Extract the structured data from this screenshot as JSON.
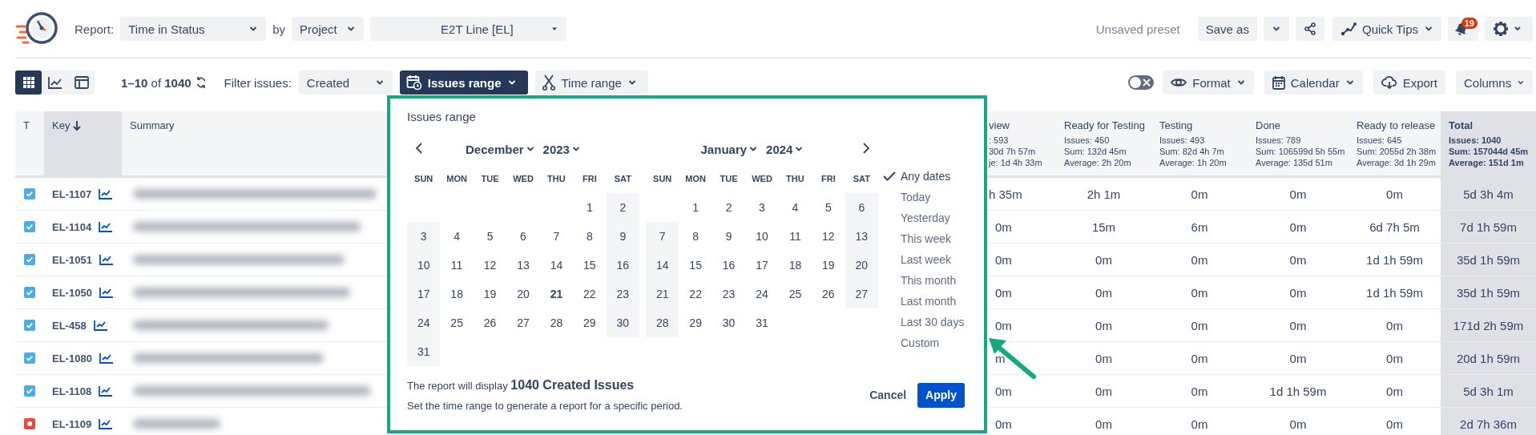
{
  "header": {
    "report_label": "Report:",
    "report_select": "Time in Status",
    "by_label": "by",
    "group_select": "Project",
    "project_select": "E2T Line [EL]",
    "preset_status": "Unsaved preset",
    "save_as": "Save as",
    "quick_tips": "Quick Tips",
    "notifications": "19"
  },
  "toolbar": {
    "view_modes": [
      {
        "selected": true
      },
      {
        "selected": false
      },
      {
        "selected": false
      }
    ],
    "pagination": "**1–10** of **1040**",
    "filter_label": "Filter issues:",
    "filter_select": "Created",
    "issues_range": {
      "label": "Issues range",
      "open": true
    },
    "time_range": {
      "label": "Time range",
      "open": false
    },
    "toggle": {
      "on": false
    },
    "format": "Format",
    "calendar": "Calendar",
    "export": "Export",
    "columns": "Columns"
  },
  "table": {
    "fixed_columns": [
      {
        "label": "T",
        "sorted": false
      },
      {
        "label": "Key",
        "sorted": true
      },
      {
        "label": "Summary",
        "sorted": false
      }
    ],
    "status_columns": [
      {
        "label": "view",
        "stats": [
          ": 593",
          "30d 7h 57m",
          "je: 1d 4h 33m"
        ]
      },
      {
        "label": "Ready for Testing",
        "stats": [
          "Issues: 450",
          "Sum: 132d 45m",
          "Average: 2h 20m"
        ]
      },
      {
        "label": "Testing",
        "stats": [
          "Issues: 493",
          "Sum: 82d 4h 7m",
          "Average: 1h 20m"
        ]
      },
      {
        "label": "Done",
        "stats": [
          "Issues: 789",
          "Sum: 106599d 5h 55m",
          "Average: 135d 51m"
        ]
      },
      {
        "label": "Ready to release",
        "stats": [
          "Issues: 645",
          "Sum: 2055d 2h 38m",
          "Average: 3d 1h 29m"
        ]
      },
      {
        "label": "Total",
        "stats": [
          "Issues: 1040",
          "Sum: 157044d 45m",
          "Average: 151d 1m"
        ]
      }
    ],
    "issues": [
      {
        "kind": "task",
        "key": "EL-1107",
        "times": [
          "h 35m",
          "2h 1m",
          "0m",
          "0m",
          "0m",
          "5d 3h 4m"
        ]
      },
      {
        "kind": "task",
        "key": "EL-1104",
        "times": [
          "0m",
          "15m",
          "6m",
          "0m",
          "6d 7h 5m",
          "7d 1h 59m"
        ]
      },
      {
        "kind": "task",
        "key": "EL-1051",
        "times": [
          "0m",
          "0m",
          "0m",
          "0m",
          "1d 1h 59m",
          "35d 1h 59m"
        ]
      },
      {
        "kind": "task",
        "key": "EL-1050",
        "times": [
          "0m",
          "0m",
          "0m",
          "0m",
          "1d 1h 59m",
          "35d 1h 59m"
        ]
      },
      {
        "kind": "task",
        "key": "EL-458",
        "times": [
          "0m",
          "0m",
          "0m",
          "0m",
          "0m",
          "171d 2h 59m"
        ]
      },
      {
        "kind": "task",
        "key": "EL-1080",
        "times": [
          "m",
          "0m",
          "0m",
          "0m",
          "0m",
          "20d 1h 59m"
        ]
      },
      {
        "kind": "task",
        "key": "EL-1108",
        "times": [
          "0m",
          "0m",
          "0m",
          "1d 1h 59m",
          "0m",
          "5d 3h 1m"
        ]
      },
      {
        "kind": "bug",
        "key": "EL-1109",
        "times": [
          "0m",
          "0m",
          "0m",
          "0m",
          "0m",
          "2d 7h 36m"
        ]
      }
    ]
  },
  "popup": {
    "title": "Issues range",
    "months": [
      {
        "month": "December",
        "year": "2023",
        "weekdays": [
          "SUN",
          "MON",
          "TUE",
          "WED",
          "THU",
          "FRI",
          "SAT"
        ],
        "weeks": [
          {
            "right_aligned": true,
            "days": [
              {
                "day": "1",
                "today": false
              },
              {
                "day": "2",
                "today": false
              }
            ]
          },
          {
            "days": [
              {
                "day": "3",
                "today": false
              },
              {
                "day": "4",
                "today": false
              },
              {
                "day": "5",
                "today": false
              },
              {
                "day": "6",
                "today": false
              },
              {
                "day": "7",
                "today": false
              },
              {
                "day": "8",
                "today": false
              },
              {
                "day": "9",
                "today": false
              }
            ]
          },
          {
            "days": [
              {
                "day": "10",
                "today": false
              },
              {
                "day": "11",
                "today": false
              },
              {
                "day": "12",
                "today": false
              },
              {
                "day": "13",
                "today": false
              },
              {
                "day": "14",
                "today": false
              },
              {
                "day": "15",
                "today": false
              },
              {
                "day": "16",
                "today": false
              }
            ]
          },
          {
            "days": [
              {
                "day": "17",
                "today": false
              },
              {
                "day": "18",
                "today": false
              },
              {
                "day": "19",
                "today": false
              },
              {
                "day": "20",
                "today": false
              },
              {
                "day": "21",
                "today": true
              },
              {
                "day": "22",
                "today": false
              },
              {
                "day": "23",
                "today": false
              }
            ]
          },
          {
            "days": [
              {
                "day": "24",
                "today": false
              },
              {
                "day": "25",
                "today": false
              },
              {
                "day": "26",
                "today": false
              },
              {
                "day": "27",
                "today": false
              },
              {
                "day": "28",
                "today": false
              },
              {
                "day": "29",
                "today": false
              },
              {
                "day": "30",
                "today": false
              }
            ]
          },
          {
            "right_aligned": false,
            "days": [
              {
                "day": "31",
                "today": false
              }
            ]
          }
        ]
      },
      {
        "month": "January",
        "year": "2024",
        "weekdays": [
          "SUN",
          "MON",
          "TUE",
          "WED",
          "THU",
          "FRI",
          "SAT"
        ],
        "weeks": [
          {
            "right_aligned": true,
            "days": [
              {
                "day": "1",
                "today": false
              },
              {
                "day": "2",
                "today": false
              },
              {
                "day": "3",
                "today": false
              },
              {
                "day": "4",
                "today": false
              },
              {
                "day": "5",
                "today": false
              },
              {
                "day": "6",
                "today": false
              }
            ]
          },
          {
            "days": [
              {
                "day": "7",
                "today": false
              },
              {
                "day": "8",
                "today": false
              },
              {
                "day": "9",
                "today": false
              },
              {
                "day": "10",
                "today": false
              },
              {
                "day": "11",
                "today": false
              },
              {
                "day": "12",
                "today": false
              },
              {
                "day": "13",
                "today": false
              }
            ]
          },
          {
            "days": [
              {
                "day": "14",
                "today": false
              },
              {
                "day": "15",
                "today": false
              },
              {
                "day": "16",
                "today": false
              },
              {
                "day": "17",
                "today": false
              },
              {
                "day": "18",
                "today": false
              },
              {
                "day": "19",
                "today": false
              },
              {
                "day": "20",
                "today": false
              }
            ]
          },
          {
            "days": [
              {
                "day": "21",
                "today": false
              },
              {
                "day": "22",
                "today": false
              },
              {
                "day": "23",
                "today": false
              },
              {
                "day": "24",
                "today": false
              },
              {
                "day": "25",
                "today": false
              },
              {
                "day": "26",
                "today": false
              },
              {
                "day": "27",
                "today": false
              }
            ]
          },
          {
            "right_aligned": false,
            "days": [
              {
                "day": "28",
                "today": false
              },
              {
                "day": "29",
                "today": false
              },
              {
                "day": "30",
                "today": false
              },
              {
                "day": "31",
                "today": false
              }
            ]
          }
        ]
      }
    ],
    "presets": [
      {
        "label": "Any dates",
        "selected": true
      },
      {
        "label": "Today",
        "selected": false
      },
      {
        "label": "Yesterday",
        "selected": false
      },
      {
        "label": "This week",
        "selected": false
      },
      {
        "label": "Last week",
        "selected": false
      },
      {
        "label": "This month",
        "selected": false
      },
      {
        "label": "Last month",
        "selected": false
      },
      {
        "label": "Last 30 days",
        "selected": false
      },
      {
        "label": "Custom",
        "selected": false
      }
    ],
    "summary": "The report will display **1040 Created Issues**",
    "hint": "Set the time range to generate a report for a specific period.",
    "cancel": "Cancel",
    "apply": "Apply"
  }
}
